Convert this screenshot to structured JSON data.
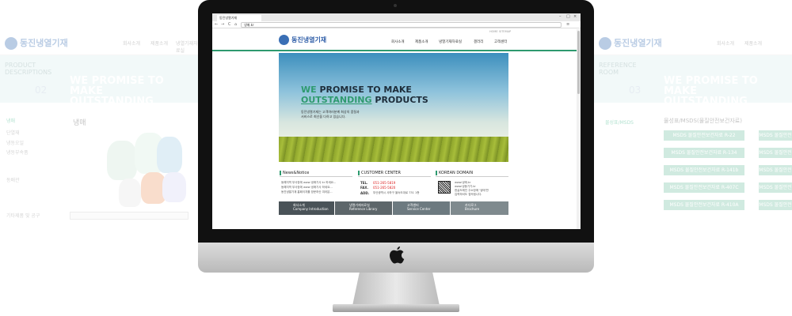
{
  "background_left": {
    "logo": "동진냉열기재",
    "nav": [
      "회사소개",
      "제품소개",
      "냉열기재자료실"
    ],
    "desc": "PRODUCT DESCRIPTIONS",
    "number": "02",
    "promise_line1": "WE PROMISE TO MAKE",
    "promise_line2": "OUTSTANDING PRODUCTS",
    "side_items": [
      "냉매",
      "단열재",
      "냉동오일",
      "냉동부속품",
      "동배관",
      "기타제품 및 공구"
    ],
    "category": "냉매"
  },
  "background_right": {
    "logo": "동진냉열기재",
    "nav": [
      "회사소개",
      "제품소개"
    ],
    "desc": "REFERENCE ROOM",
    "number": "03",
    "promise_line1": "WE PROMISE TO MAKE",
    "promise_line2": "OUTSTANDING PRODUCTS",
    "side_item": "물성표/MSDS",
    "category": "물성표/MSDS(물질안전보건자료)",
    "buttons": [
      "MSDS 물질안전보건자료 R-22",
      "MSDS 물질안전보건자료 R-134",
      "MSDS 물질안전보건자료 R-141b",
      "MSDS 물질안전보건자료 R-407C",
      "MSDS 물질안전보건자료 R-410A"
    ]
  },
  "browser": {
    "tab_title": "동진냉열기재",
    "url": "냉매.kr",
    "nav_back": "←",
    "nav_forward": "→",
    "nav_reload": "C",
    "nav_home": "⌂",
    "menu_icon": "≡",
    "win_min": "–",
    "win_max": "□",
    "win_close": "×"
  },
  "site": {
    "logo": "동진냉열기재",
    "util_links": [
      "HOME",
      "SITEMAP"
    ],
    "menu": [
      "회사소개",
      "제품소개",
      "냉열기재자료실",
      "갤러리",
      "고객센터"
    ],
    "hero": {
      "we": "WE",
      "line1_rest": "PROMISE TO MAKE",
      "outstanding": "OUTSTANDING",
      "line2_rest": "PRODUCTS",
      "sub1": "동진냉열기재는 고객여러분께 최상의 품질과",
      "sub2": "서비스로 최선을 다하고 있습니다."
    },
    "news": {
      "title": "News&Notice",
      "items": [
        "동해지역 부사장에 www 냉매기사 kr 하세요...",
        "동해지역 부사장에 www 냉매기사 하세요...",
        "동진냉열기재 홈페이지를 방문하신 여러분..."
      ]
    },
    "customer": {
      "title": "CUSTOMER CENTER",
      "tel_label": "TEL.",
      "tel": "051-265-5819",
      "fax_label": "FAX.",
      "fax": "051-265-5820",
      "addr_label": "ADD.",
      "addr": "부산광역시 사하구 을숙도대로 731 1층"
    },
    "domain": {
      "title": "KOREAN DOMAIN",
      "items": [
        "www.냉매.kr",
        "www.냉동기기.kr",
        "한글도메인 주소창에 '냉매'만",
        "입력하셔도 접속됩니다."
      ]
    },
    "quicklinks": [
      {
        "title": "회사소개",
        "sub": "Company Introduction"
      },
      {
        "title": "냉열기재자료실",
        "sub": "Reference Library"
      },
      {
        "title": "고객센터",
        "sub": "Service Center"
      },
      {
        "title": "카다로그",
        "sub": "Brochure"
      }
    ]
  },
  "colors": {
    "accent_green": "#2e9a6f",
    "logo_blue": "#3a6fb5",
    "tel_red": "#dd2222"
  }
}
